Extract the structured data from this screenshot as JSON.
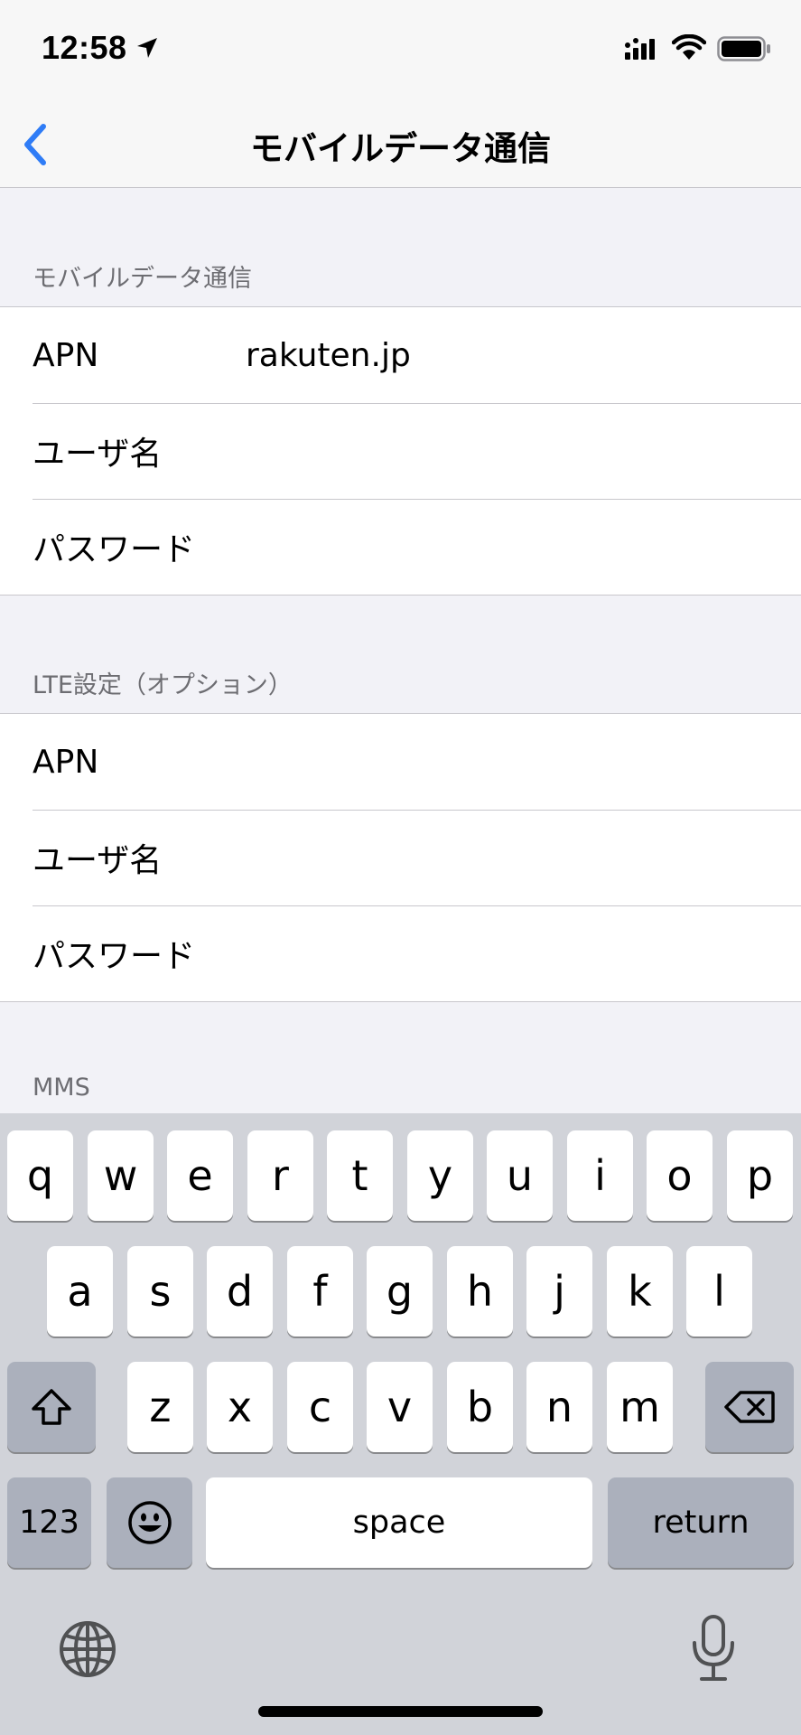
{
  "status_bar": {
    "time": "12:58"
  },
  "nav": {
    "title": "モバイルデータ通信"
  },
  "section1": {
    "header": "モバイルデータ通信",
    "rows": [
      {
        "label": "APN",
        "value": "rakuten.jp"
      },
      {
        "label": "ユーザ名",
        "value": ""
      },
      {
        "label": "パスワード",
        "value": ""
      }
    ]
  },
  "section2": {
    "header": "LTE設定（オプション）",
    "rows": [
      {
        "label": "APN",
        "value": ""
      },
      {
        "label": "ユーザ名",
        "value": ""
      },
      {
        "label": "パスワード",
        "value": ""
      }
    ]
  },
  "section3": {
    "header": "MMS"
  },
  "keyboard": {
    "row1": [
      "q",
      "w",
      "e",
      "r",
      "t",
      "y",
      "u",
      "i",
      "o",
      "p"
    ],
    "row2": [
      "a",
      "s",
      "d",
      "f",
      "g",
      "h",
      "j",
      "k",
      "l"
    ],
    "row3": [
      "z",
      "x",
      "c",
      "v",
      "b",
      "n",
      "m"
    ],
    "numbers_key": "123",
    "space_key": "space",
    "return_key": "return"
  },
  "icons": [
    "location-arrow-icon",
    "signal-icon",
    "wifi-icon",
    "battery-icon",
    "back-chevron-icon",
    "shift-icon",
    "delete-icon",
    "emoji-icon",
    "globe-icon",
    "microphone-icon"
  ]
}
